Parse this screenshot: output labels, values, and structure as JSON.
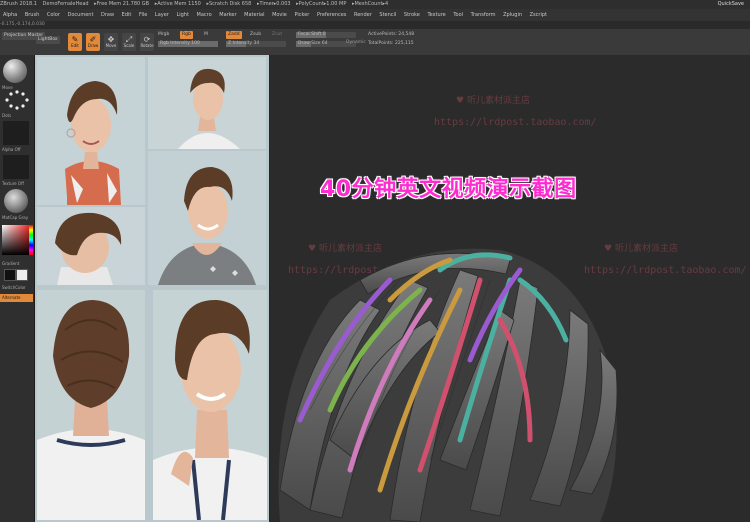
{
  "titlebar": {
    "items": [
      "ZBrush 2018.1",
      "DemoFemaleHead",
      "▸Free Mem 21.780 GB",
      "▸Active Mem 1150",
      "▸Scratch Disk 658",
      "▸Timer▸0.003",
      "▸PolyCount▸1.00 MP",
      "▸MeshCount▸4"
    ],
    "quicksave_label": "QuickSave"
  },
  "menubar": {
    "items": [
      "Alpha",
      "Brush",
      "Color",
      "Document",
      "Draw",
      "Edit",
      "File",
      "Layer",
      "Light",
      "Macro",
      "Marker",
      "Material",
      "Movie",
      "Picker",
      "Preferences",
      "Render",
      "Stencil",
      "Stroke",
      "Texture",
      "Tool",
      "Transform",
      "Zplugin",
      "Zscript"
    ]
  },
  "statusline": {
    "text": "-0.175,-0.174,0.030"
  },
  "shelf": {
    "lightbox_label": "LightBox",
    "projection_label": "Projection Master",
    "tools": [
      {
        "name": "edit",
        "label": "Edit",
        "icon": "edit-icon",
        "active": true
      },
      {
        "name": "draw",
        "label": "Draw",
        "icon": "draw-icon",
        "active": true
      },
      {
        "name": "move",
        "label": "Move",
        "icon": "move-icon",
        "active": false
      },
      {
        "name": "scale",
        "label": "Scale",
        "icon": "scale-icon",
        "active": false
      },
      {
        "name": "rotate",
        "label": "Rotate",
        "icon": "rotate-icon",
        "active": false
      }
    ],
    "mrgb_label": "Mrgb",
    "rgb_label": "Rgb",
    "m_label": "M",
    "rgb_intensity_label": "Rgb Intensity 100",
    "zadd_label": "Zadd",
    "zsub_label": "Zsub",
    "zcut_label": "Zcut",
    "z_intensity_label": "Z Intensity 34",
    "focal_shift_label": "Focal Shift 0",
    "draw_size_label": "Draw Size 64",
    "dynamic_label": "Dynamic",
    "active_points_label": "ActivePoints: 24,548",
    "total_points_label": "TotalPoints: 225,115"
  },
  "lefttray": {
    "brush_label": "Move",
    "stroke_label": "Dots",
    "alpha_label": "Alpha Off",
    "texture_label": "Texture Off",
    "material_label": "MatCap Gray",
    "gradient_label": "Gradient",
    "switch_color_label": "SwitchColor",
    "alternate_label": "Alternate"
  },
  "canvas": {
    "banner_text": "40分钟英文视频演示截图",
    "watermark_shop": "听儿素材派主店",
    "watermark_url": "https://lrdpost.taobao.com/"
  },
  "colors": {
    "accent_orange": "#e2893a",
    "banner_magenta": "#ff2bd0",
    "hair_stripe_colors": [
      "#9b5bd0",
      "#4bb0a0",
      "#d0506e",
      "#c99a3e",
      "#7db34c",
      "#d07bbd"
    ]
  }
}
